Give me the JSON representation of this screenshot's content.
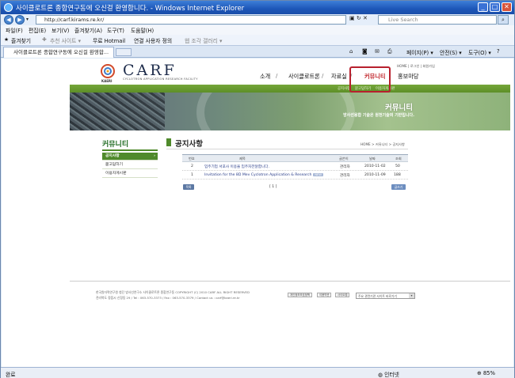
{
  "window": {
    "title": "사이클로트론 종합연구동에 오신걸 환영합니다. - Windows Internet Explorer",
    "address": "http://carf.kirams.re.kr/",
    "search_placeholder": "Live Search",
    "tab_title": "사이클로트론 종합연구동에 오신걸 환영합...",
    "menus": [
      "파일(F)",
      "편집(E)",
      "보기(V)",
      "즐겨찾기(A)",
      "도구(T)",
      "도움말(H)"
    ],
    "favorites_label": "즐겨찾기",
    "favorites": [
      "추천 사이트 ▾",
      "무료 Hotmail",
      "연결 사용자 정의",
      "웹 조각 갤러리 ▾"
    ],
    "commands": [
      "페이지(P) ▾",
      "안전(S) ▾",
      "도구(O) ▾"
    ],
    "status_left": "완료",
    "status_zone": "인터넷",
    "status_zoom": "85%"
  },
  "site": {
    "logo_text": "CARF",
    "logo_sub": "CYCLOTRON APPLICATION RESEARCH FACILITY",
    "logo_org": "KAERI",
    "mini_links": "HOME  |  로그인  |  회원가입",
    "gnb": [
      "소개",
      "사이클로트론",
      "자료실",
      "커뮤니티",
      "홍보마당"
    ],
    "subnav": [
      "공지사항",
      "묻고답하기",
      "이용자게시판"
    ],
    "hero_title": "커뮤니티",
    "hero_sub": "방사선융합 기술은 원천기술의 기반입니다."
  },
  "lnb": {
    "title": "커뮤니티",
    "items": [
      "공지사항",
      "묻고답하기",
      "이용자게시판"
    ]
  },
  "content": {
    "title": "공지사항",
    "breadcrumb": "HOME > 커뮤니티 > 공지사항",
    "columns": [
      "번호",
      "제목",
      "글쓴이",
      "날짜",
      "조회"
    ],
    "rows": [
      {
        "no": "2",
        "subject": "입주기업 서포사 이용을 입주자전달합니다.",
        "writer": "관리자",
        "date": "2010-11-02",
        "hits": "50"
      },
      {
        "no": "1",
        "subject": "Invitation for the 8D Mev Cyclotron Application & Research",
        "badge": "NEW",
        "writer": "관리자",
        "date": "2010-11-09",
        "hits": "188"
      }
    ],
    "list_button": "목록",
    "pager": "[ 1 ]",
    "write_button": "글쓰기"
  },
  "footer": {
    "line1": "한국원자력연구원 첨단 방사선연구소 사이클로트론 종합연구동   COPYRIGHT (C) 2010 CARF ALL RIGHT RESERVED",
    "line2": "전라북도 정읍시 신정동 29   /  Tel : 063-570-3373  /  Fax : 063-570-3379  /  Contact us : carf@kaeri.re.kr",
    "buttons": [
      "개인정보보호정책",
      "이용약관",
      "사이트맵"
    ],
    "family_site": "주요 관련기관 사이트 바로가기"
  },
  "colors": {
    "accent_green": "#4f8a2b",
    "active_red": "#b8202e",
    "ie_titlebar": "#1d56b8"
  }
}
